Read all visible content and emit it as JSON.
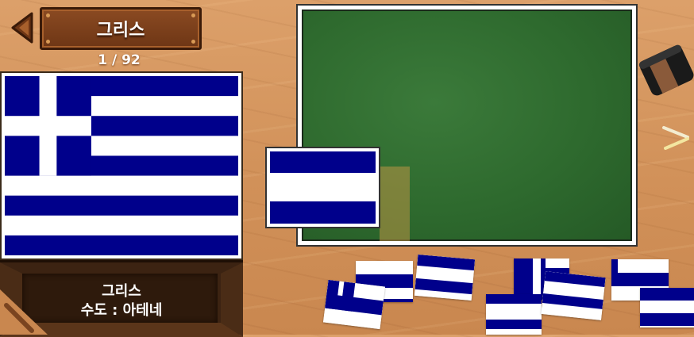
{
  "header": {
    "title": "그리스",
    "progress": "1 / 92"
  },
  "info": {
    "country": "그리스",
    "capital_line": "수도 : 아테네"
  },
  "colors": {
    "flag_blue": "#00008b",
    "flag_white": "#ffffff",
    "chalkboard": "#2e6a2e",
    "wood": "#d2925a"
  },
  "icons": {
    "back": "back-triangle-icon",
    "eraser": "eraser-icon",
    "chalk": "chalk-icon"
  }
}
